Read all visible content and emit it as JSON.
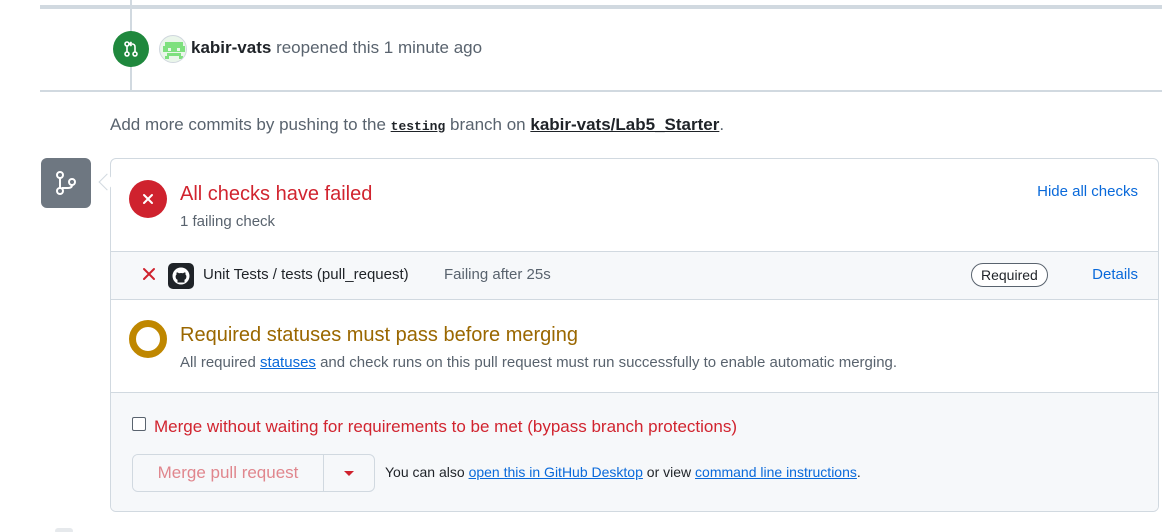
{
  "event": {
    "username": "kabir-vats",
    "action": "reopened this 1 minute ago",
    "icon": "git-pull-request-icon"
  },
  "hint": {
    "prefix": "Add more commits by pushing to the",
    "branch": "testing",
    "middle": "branch on",
    "repo": "kabir-vats/Lab5_Starter",
    "suffix": "."
  },
  "checks": {
    "title": "All checks have failed",
    "subtitle": "1 failing check",
    "hide_label": "Hide all checks",
    "items": [
      {
        "name": "Unit Tests / tests (pull_request)",
        "state": "Failing after 25s",
        "badge": "Required",
        "details_label": "Details",
        "status": "failed"
      }
    ]
  },
  "status_requirements": {
    "title": "Required statuses must pass before merging",
    "text_before": "All required",
    "link_label": "statuses",
    "text_after": "and check runs on this pull request must run successfully to enable automatic merging."
  },
  "merge": {
    "bypass_label": "Merge without waiting for requirements to be met (bypass branch protections)",
    "bypass_checked": false,
    "button_label": "Merge pull request",
    "alt_prefix": "You can also",
    "desktop_link": "open this in GitHub Desktop",
    "alt_middle": "or view",
    "cli_link": "command line instructions",
    "alt_suffix": "."
  },
  "colors": {
    "success": "#1f883d",
    "danger": "#cf222e",
    "attention": "#bf8700",
    "accent": "#0969da",
    "border": "#d1d9e0",
    "muted_bg": "#f6f8fa",
    "muted_text": "#59636e"
  }
}
